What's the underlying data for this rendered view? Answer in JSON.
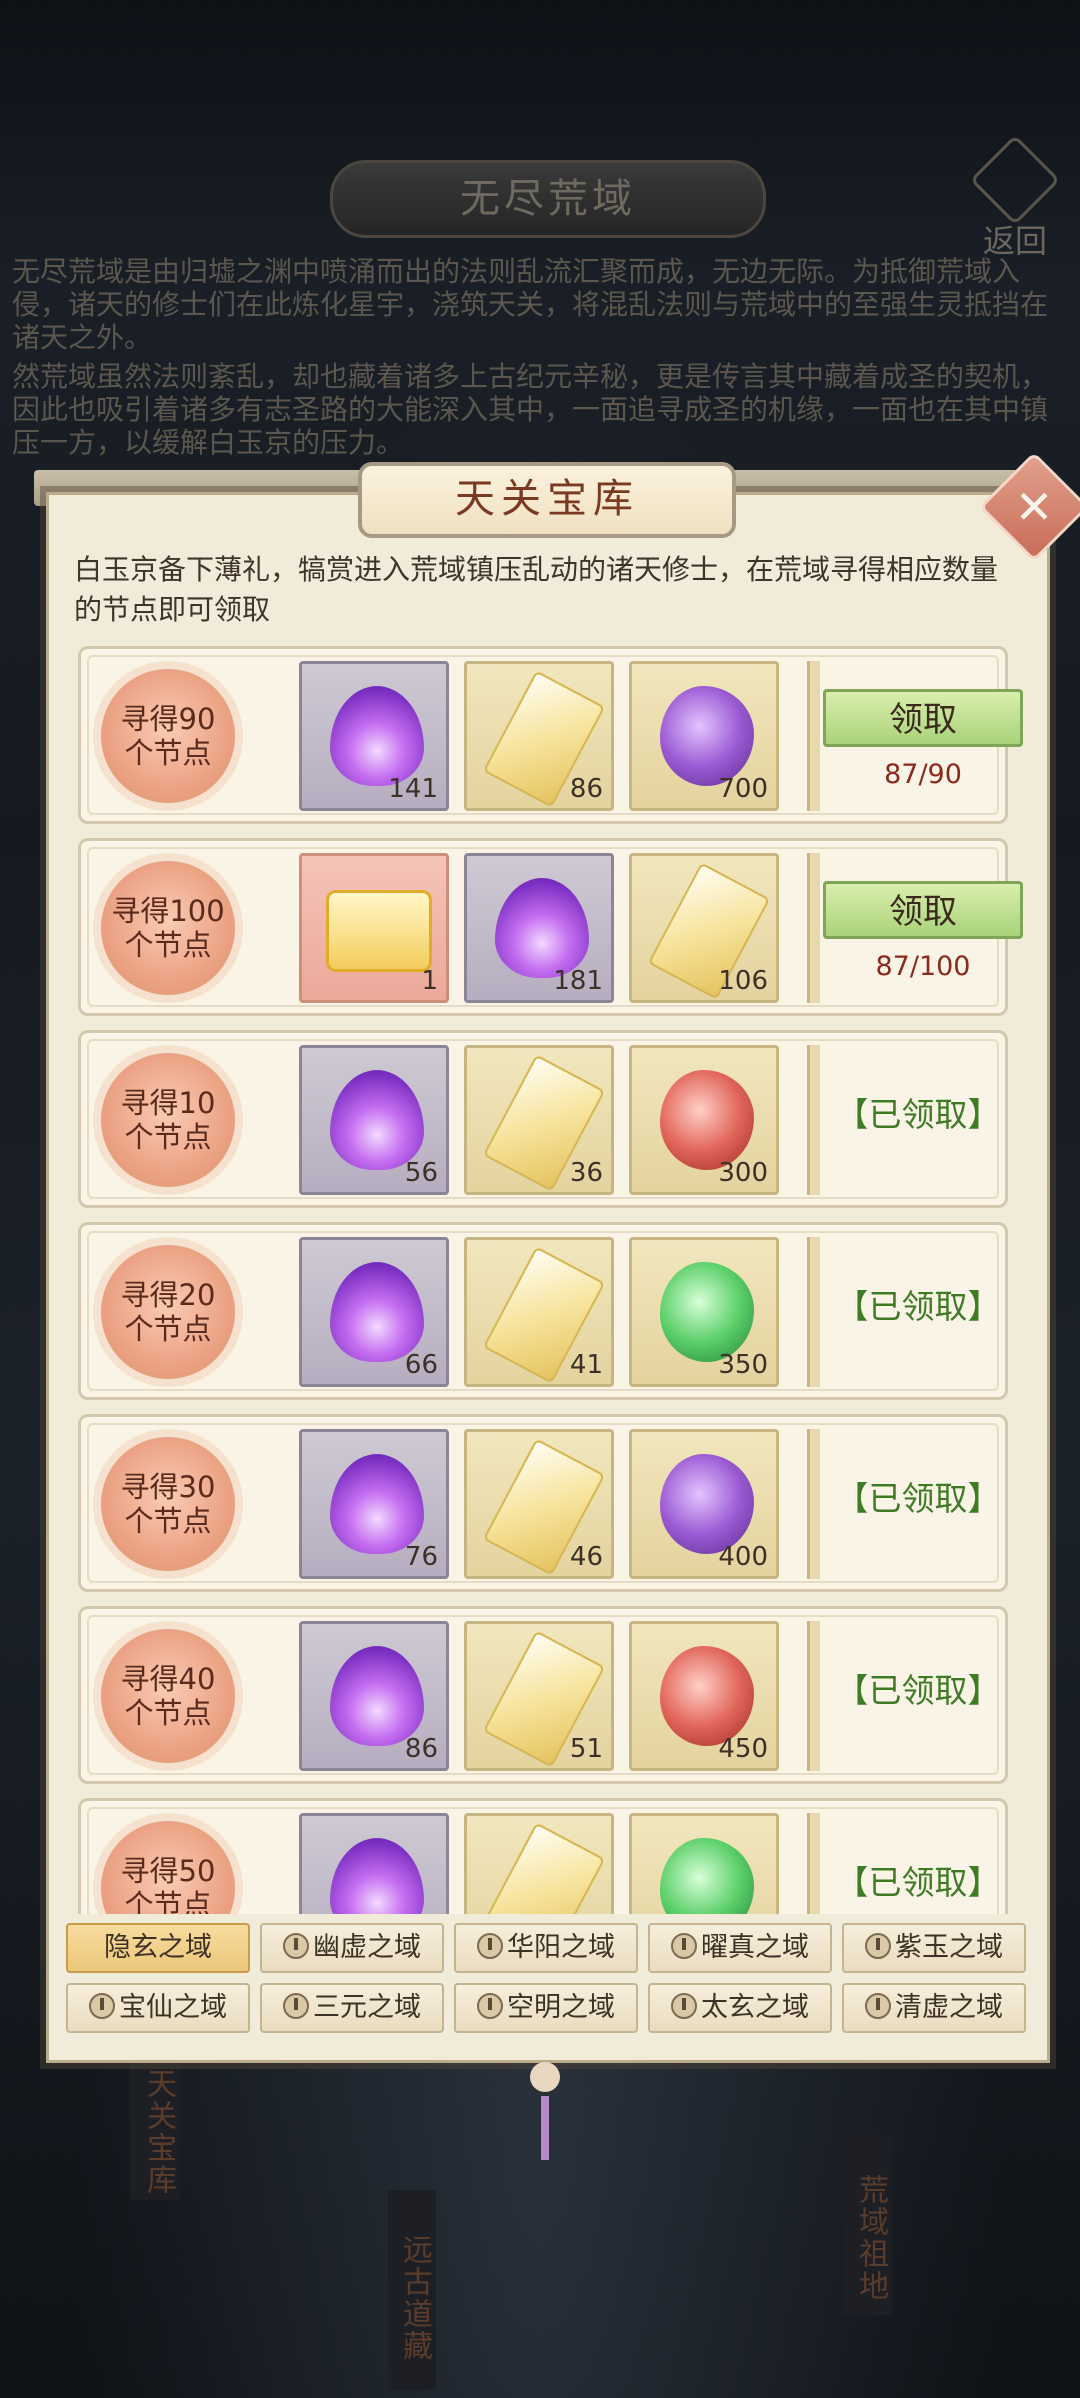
{
  "header": {
    "title": "无尽荒域",
    "back_label": "返回"
  },
  "intro": {
    "paragraph1": "无尽荒域是由归墟之渊中喷涌而出的法则乱流汇聚而成，无边无际。为抵御荒域入侵，诸天的修士们在此炼化星宇，浇筑天关，将混乱法则与荒域中的至强生灵抵挡在诸天之外。",
    "paragraph2": "然荒域虽然法则紊乱，却也藏着诸多上古纪元辛秘，更是传言其中藏着成圣的契机，因此也吸引着诸多有志圣路的大能深入其中，一面追寻成圣的机缘，一面也在其中镇压一方，以缓解白玉京的压力。"
  },
  "background_labels": [
    "天关宝库",
    "远古道藏",
    "荒域祖地"
  ],
  "panel": {
    "title": "天关宝库",
    "close_icon": "close-icon",
    "description": "白玉京备下薄礼，犒赏进入荒域镇压乱动的诸天修士，在荒域寻得相应数量的节点即可领取"
  },
  "rewards": [
    {
      "requirement": "寻得90个节点",
      "items": [
        {
          "icon": "purple-flame-icon",
          "frame": "purple",
          "qty": "141"
        },
        {
          "icon": "gold-crystal-icon",
          "frame": "gold",
          "qty": "86"
        },
        {
          "icon": "purple-stone-icon",
          "frame": "gold",
          "qty": "700"
        }
      ],
      "state": "claimable",
      "button_label": "领取",
      "progress": "87/90"
    },
    {
      "requirement": "寻得100个节点",
      "items": [
        {
          "icon": "gold-scroll-icon",
          "frame": "red",
          "qty": "1"
        },
        {
          "icon": "purple-flame-icon",
          "frame": "purple",
          "qty": "181"
        },
        {
          "icon": "gold-crystal-icon",
          "frame": "gold",
          "qty": "106"
        }
      ],
      "state": "claimable",
      "button_label": "领取",
      "progress": "87/100"
    },
    {
      "requirement": "寻得10个节点",
      "items": [
        {
          "icon": "purple-flame-icon",
          "frame": "purple",
          "qty": "56"
        },
        {
          "icon": "gold-crystal-icon",
          "frame": "gold",
          "qty": "36"
        },
        {
          "icon": "red-stone-icon",
          "frame": "gold",
          "qty": "300"
        }
      ],
      "state": "claimed",
      "claimed_label": "【已领取】"
    },
    {
      "requirement": "寻得20个节点",
      "items": [
        {
          "icon": "purple-flame-icon",
          "frame": "purple",
          "qty": "66"
        },
        {
          "icon": "gold-crystal-icon",
          "frame": "gold",
          "qty": "41"
        },
        {
          "icon": "green-stone-icon",
          "frame": "gold",
          "qty": "350"
        }
      ],
      "state": "claimed",
      "claimed_label": "【已领取】"
    },
    {
      "requirement": "寻得30个节点",
      "items": [
        {
          "icon": "purple-flame-icon",
          "frame": "purple",
          "qty": "76"
        },
        {
          "icon": "gold-crystal-icon",
          "frame": "gold",
          "qty": "46"
        },
        {
          "icon": "purple-stone-icon",
          "frame": "gold",
          "qty": "400"
        }
      ],
      "state": "claimed",
      "claimed_label": "【已领取】"
    },
    {
      "requirement": "寻得40个节点",
      "items": [
        {
          "icon": "purple-flame-icon",
          "frame": "purple",
          "qty": "86"
        },
        {
          "icon": "gold-crystal-icon",
          "frame": "gold",
          "qty": "51"
        },
        {
          "icon": "red-stone-icon",
          "frame": "gold",
          "qty": "450"
        }
      ],
      "state": "claimed",
      "claimed_label": "【已领取】"
    },
    {
      "requirement": "寻得50个节点",
      "items": [
        {
          "icon": "purple-flame-icon",
          "frame": "purple",
          "qty": ""
        },
        {
          "icon": "gold-crystal-icon",
          "frame": "gold",
          "qty": ""
        },
        {
          "icon": "green-stone-icon",
          "frame": "gold",
          "qty": ""
        }
      ],
      "state": "claimed",
      "claimed_label": "【已领取】"
    }
  ],
  "tabs": [
    {
      "label": "隐玄之域",
      "active": true,
      "locked": false
    },
    {
      "label": "幽虚之域",
      "active": false,
      "locked": true
    },
    {
      "label": "华阳之域",
      "active": false,
      "locked": true
    },
    {
      "label": "曜真之域",
      "active": false,
      "locked": true
    },
    {
      "label": "紫玉之域",
      "active": false,
      "locked": true
    },
    {
      "label": "宝仙之域",
      "active": false,
      "locked": true
    },
    {
      "label": "三元之域",
      "active": false,
      "locked": true
    },
    {
      "label": "空明之域",
      "active": false,
      "locked": true
    },
    {
      "label": "太玄之域",
      "active": false,
      "locked": true
    },
    {
      "label": "清虚之域",
      "active": false,
      "locked": true
    }
  ],
  "colors": {
    "claim_button": "#a9d27a",
    "claimed_text": "#3f7b26",
    "progress_text": "#8a2a1e",
    "active_tab": "#ecc77a"
  }
}
